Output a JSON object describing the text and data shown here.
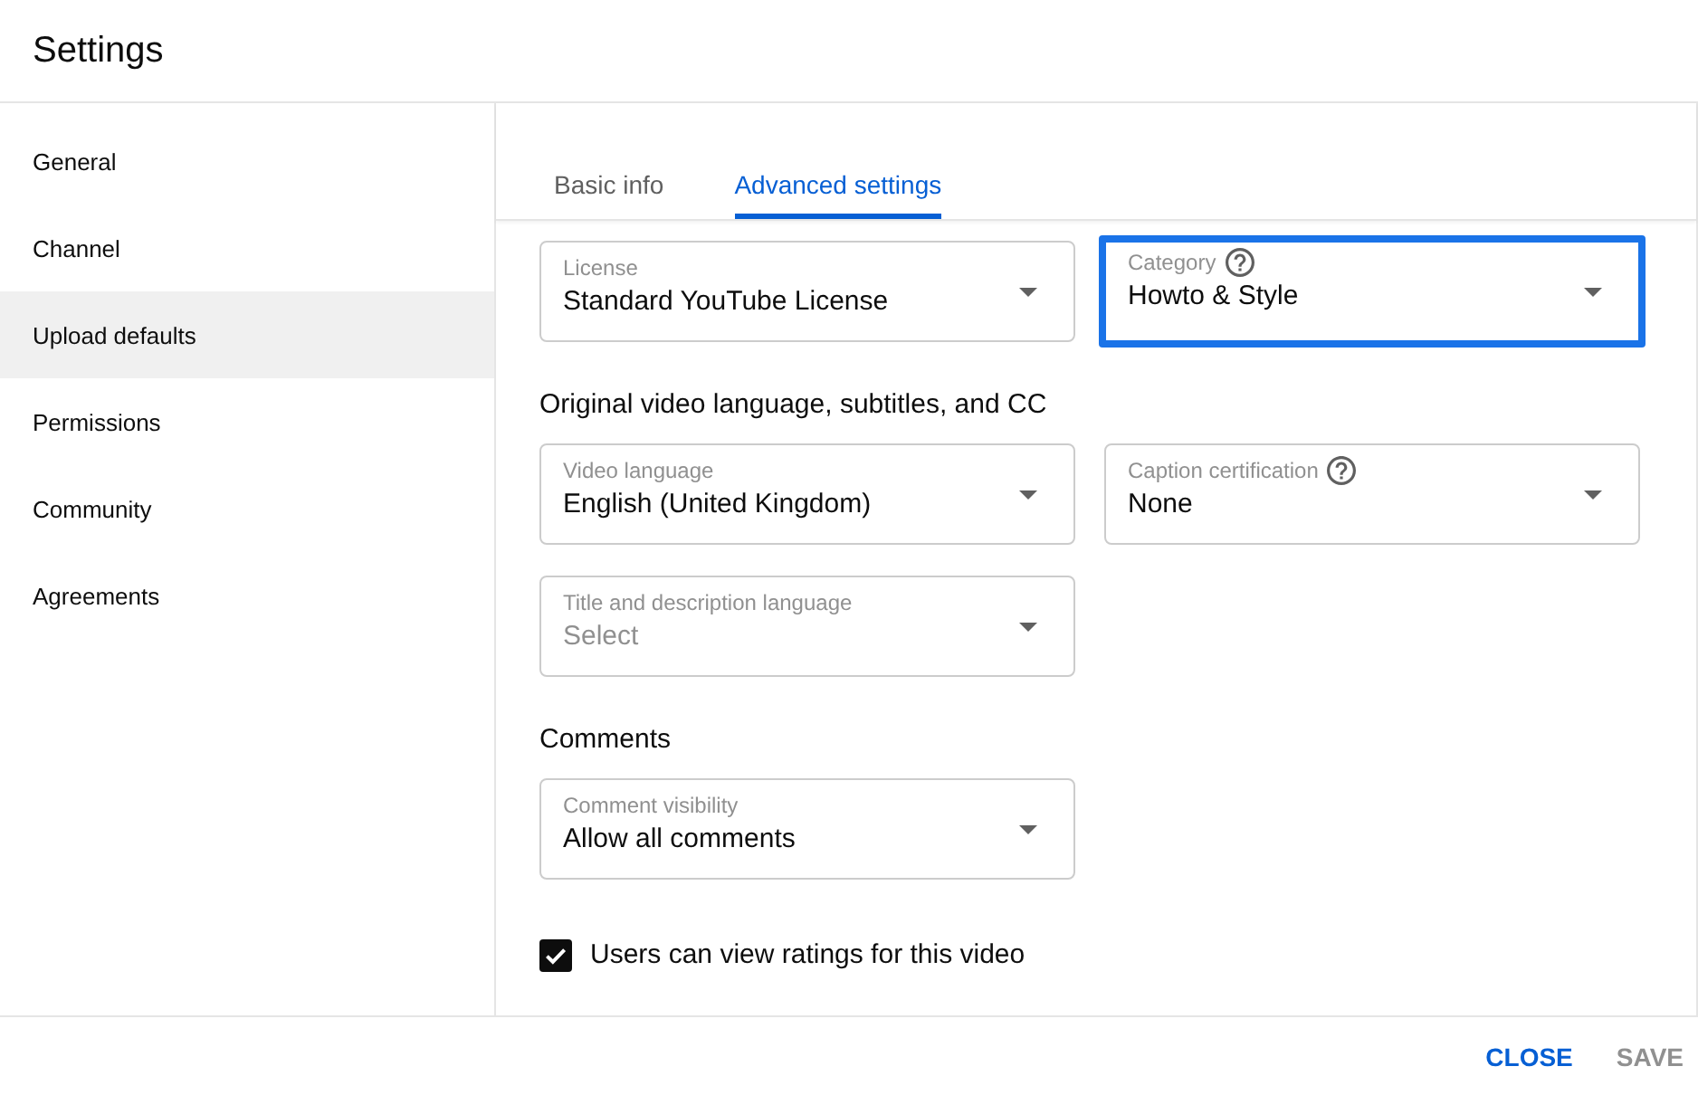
{
  "dialog": {
    "title": "Settings"
  },
  "sidebar": {
    "items": [
      {
        "label": "General",
        "selected": false
      },
      {
        "label": "Channel",
        "selected": false
      },
      {
        "label": "Upload defaults",
        "selected": true
      },
      {
        "label": "Permissions",
        "selected": false
      },
      {
        "label": "Community",
        "selected": false
      },
      {
        "label": "Agreements",
        "selected": false
      }
    ]
  },
  "tabs": [
    {
      "label": "Basic info",
      "selected": false
    },
    {
      "label": "Advanced settings",
      "selected": true
    }
  ],
  "sections": [
    {
      "fields": [
        {
          "label": "License",
          "value": "Standard YouTube License",
          "help": false,
          "highlighted": false
        },
        {
          "label": "Category",
          "value": "Howto & Style",
          "help": true,
          "highlighted": true
        }
      ]
    },
    {
      "heading": "Original video language, subtitles, and CC",
      "fields": [
        {
          "label": "Video language",
          "value": "English (United Kingdom)",
          "help": false,
          "highlighted": false
        },
        {
          "label": "Caption certification",
          "value": "None",
          "help": true,
          "highlighted": false
        },
        {
          "label": "Title and description language",
          "placeholder": "Select",
          "help": false,
          "highlighted": false
        }
      ]
    },
    {
      "heading": "Comments",
      "fields": [
        {
          "label": "Comment visibility",
          "value": "Allow all comments",
          "help": false,
          "highlighted": false
        }
      ]
    }
  ],
  "checkbox": {
    "label": "Users can view ratings for this video",
    "checked": true
  },
  "buttons": [
    {
      "label": "CLOSE",
      "disabled": false
    },
    {
      "label": "SAVE",
      "disabled": true
    }
  ]
}
